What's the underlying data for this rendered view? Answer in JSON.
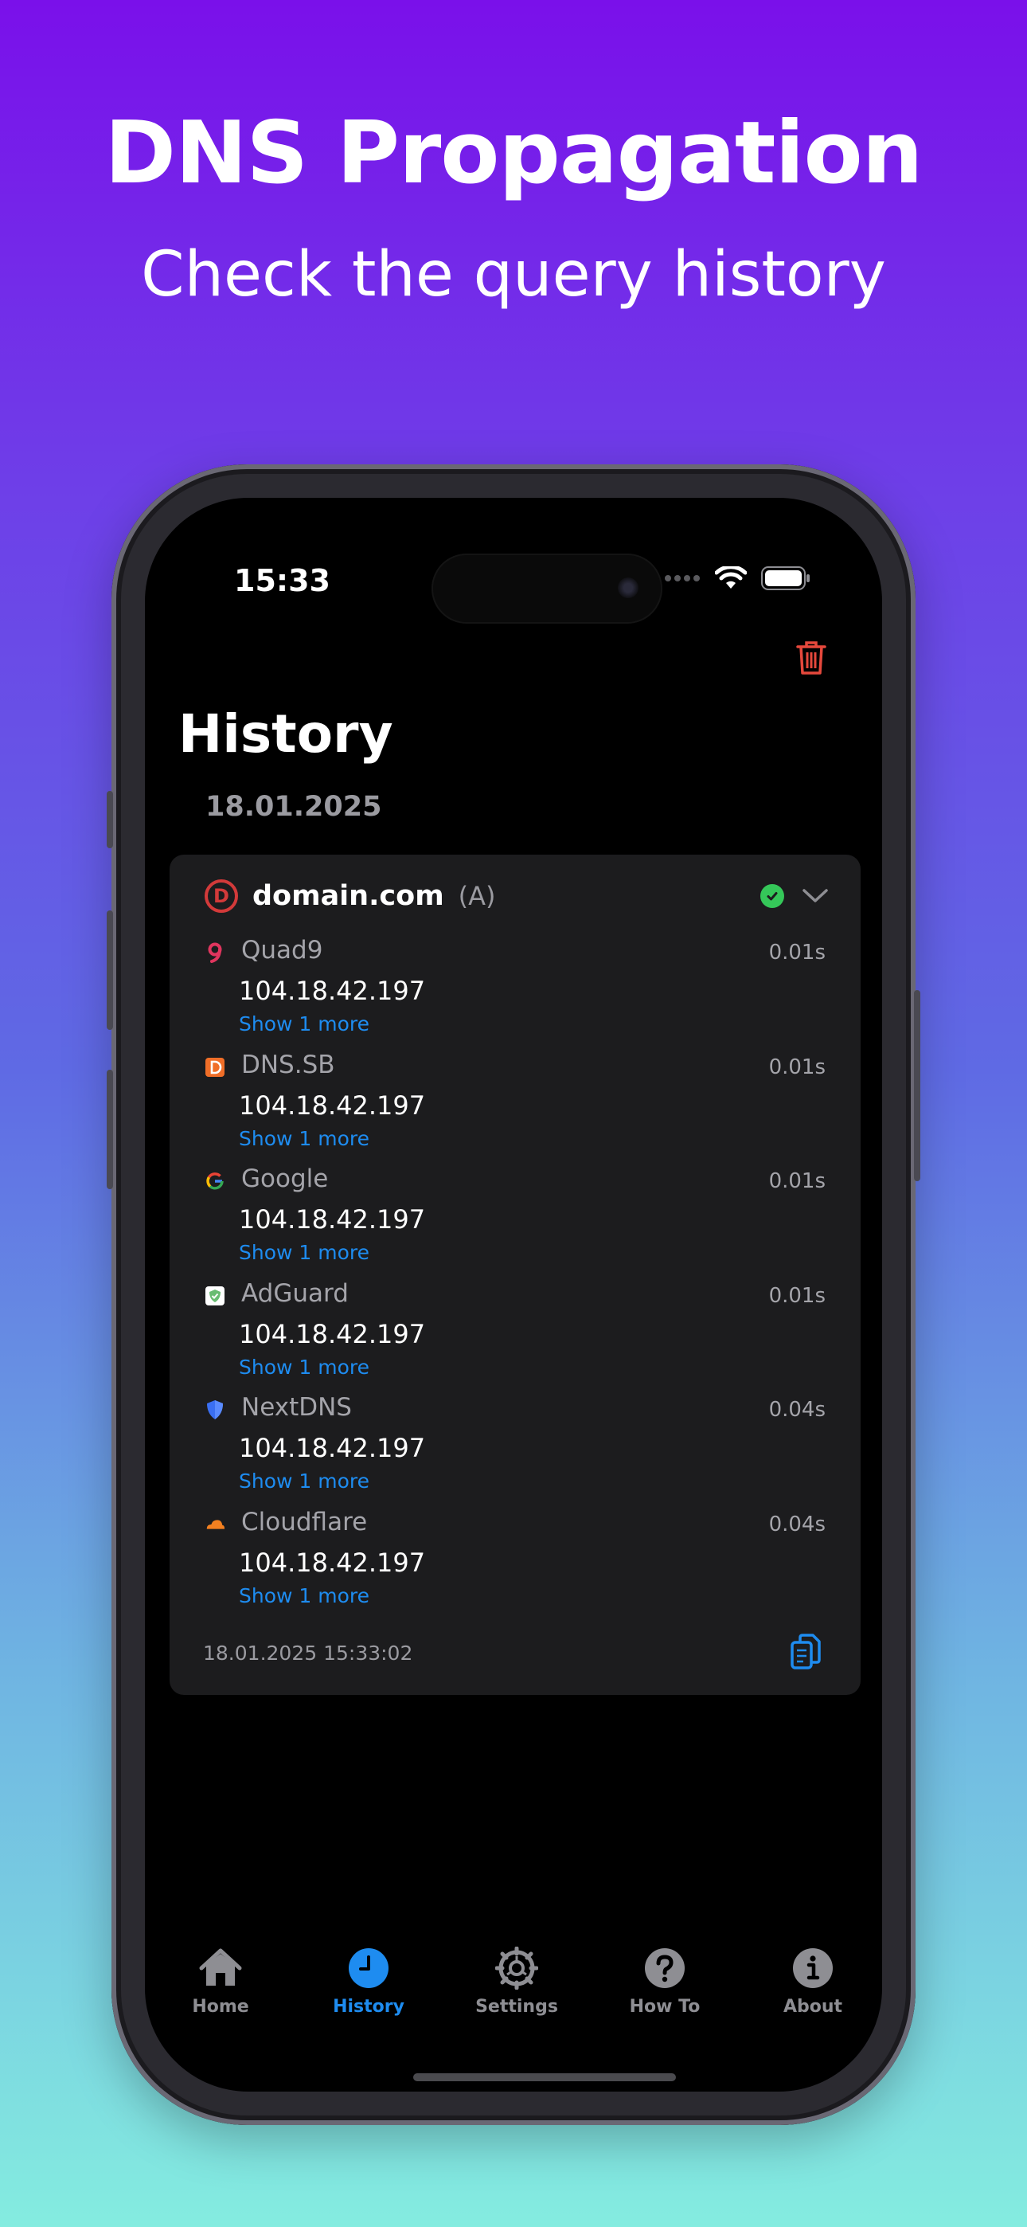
{
  "marketing": {
    "headline": "DNS Propagation",
    "subheadline": "Check the query history"
  },
  "status_bar": {
    "time": "15:33"
  },
  "page": {
    "title": "History",
    "section_date": "18.01.2025"
  },
  "query": {
    "domain": "domain.com",
    "record_type": "(A)",
    "status": "success",
    "timestamp": "18.01.2025 15:33:02",
    "results": [
      {
        "provider": "Quad9",
        "icon": "quad9-icon",
        "time": "0.01s",
        "ip": "104.18.42.197",
        "more": "Show 1 more"
      },
      {
        "provider": "DNS.SB",
        "icon": "dnssb-icon",
        "time": "0.01s",
        "ip": "104.18.42.197",
        "more": "Show 1 more"
      },
      {
        "provider": "Google",
        "icon": "google-icon",
        "time": "0.01s",
        "ip": "104.18.42.197",
        "more": "Show 1 more"
      },
      {
        "provider": "AdGuard",
        "icon": "adguard-icon",
        "time": "0.01s",
        "ip": "104.18.42.197",
        "more": "Show 1 more"
      },
      {
        "provider": "NextDNS",
        "icon": "nextdns-icon",
        "time": "0.04s",
        "ip": "104.18.42.197",
        "more": "Show 1 more"
      },
      {
        "provider": "Cloudflare",
        "icon": "cloudflare-icon",
        "time": "0.04s",
        "ip": "104.18.42.197",
        "more": "Show 1 more"
      }
    ]
  },
  "tabs": [
    {
      "label": "Home",
      "icon": "house-icon",
      "active": false
    },
    {
      "label": "History",
      "icon": "clock-icon",
      "active": true
    },
    {
      "label": "Settings",
      "icon": "gear-icon",
      "active": false
    },
    {
      "label": "How To",
      "icon": "question-icon",
      "active": false
    },
    {
      "label": "About",
      "icon": "info-icon",
      "active": false
    }
  ],
  "colors": {
    "accent": "#1e8cf0",
    "destructive": "#e5483c",
    "success": "#35c759",
    "card": "#1c1c1e"
  }
}
